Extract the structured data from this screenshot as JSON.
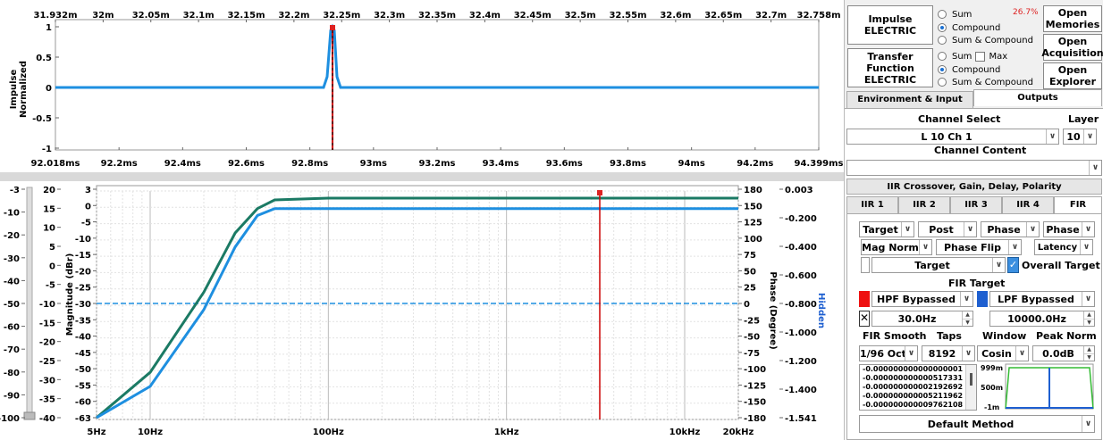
{
  "top_plot": {
    "ylabel": "Impulse\nNormalized",
    "time_ticks": [
      "31.932m",
      "32m",
      "32.05m",
      "32.1m",
      "32.15m",
      "32.2m",
      "32.25m",
      "32.3m",
      "32.35m",
      "32.4m",
      "32.45m",
      "32.5m",
      "32.55m",
      "32.6m",
      "32.65m",
      "32.7m",
      "32.758m"
    ],
    "ms_ticks": [
      "92.018ms",
      "92.2ms",
      "92.4ms",
      "92.6ms",
      "92.8ms",
      "93ms",
      "93.2ms",
      "93.4ms",
      "93.6ms",
      "93.8ms",
      "94ms",
      "94.2ms",
      "94.399ms"
    ],
    "y_ticks": [
      "1",
      "0.5",
      "0",
      "-0.5",
      "-1"
    ]
  },
  "bottom_plot": {
    "ylabel_mag": "Magnitude (dBr)",
    "ylabel_phase": "Phase (Degree)",
    "side_label": "Hidden",
    "scale1": [
      "-3",
      "-10",
      "-20",
      "-30",
      "-40",
      "-50",
      "-60",
      "-70",
      "-80",
      "-90",
      "-100"
    ],
    "scale2": [
      "20",
      "15",
      "10",
      "5",
      "0",
      "-5",
      "-10",
      "-15",
      "-20",
      "-25",
      "-30",
      "-35",
      "-40"
    ],
    "scale3": [
      "3",
      "0",
      "-5",
      "-10",
      "-15",
      "-20",
      "-25",
      "-30",
      "-35",
      "-40",
      "-45",
      "-50",
      "-55",
      "-60",
      "-63"
    ],
    "phase_ticks": [
      "180",
      "150",
      "125",
      "100",
      "75",
      "50",
      "25",
      "0",
      "-25",
      "-50",
      "-75",
      "-100",
      "-125",
      "-150",
      "-180"
    ],
    "group_ticks": [
      "0.003",
      "-0.200",
      "-0.400",
      "-0.600",
      "-0.800",
      "-1.000",
      "-1.200",
      "-1.400",
      "-1.541"
    ],
    "freq_ticks": [
      "5Hz",
      "10Hz",
      "100Hz",
      "1kHz",
      "10kHz",
      "20kHz"
    ]
  },
  "chart_data": {
    "type": "line",
    "x": [
      5,
      10,
      20,
      30,
      40,
      50,
      100,
      1000,
      10000,
      20000
    ],
    "series": [
      {
        "values": [
          -63,
          -50,
          -27,
          -10,
          -3,
          -0.5,
          0,
          0,
          0,
          0
        ],
        "color": "#1b7a64"
      },
      {
        "values": [
          -63,
          -54,
          -32,
          -14,
          -5,
          -3,
          -3,
          -3,
          -3,
          -3
        ],
        "color": "#1e8fe0"
      }
    ],
    "xlim": [
      5,
      20000
    ],
    "ylim": [
      -63,
      3
    ],
    "xscale": "log",
    "grid": true
  },
  "panel": {
    "impulse_btn": "Impulse\nELECTRIC",
    "percent": "26.7%",
    "open_memories": "Open\nMemories",
    "open_acquisition": "Open\nAcquisition",
    "open_explorer": "Open\nExplorer",
    "transfer_btn": "Transfer\nFunction\nELECTRIC",
    "radio_sum": "Sum",
    "radio_compound": "Compound",
    "radio_sum_compound": "Sum & Compound",
    "check_max": "Max",
    "tab_env": "Environment & Input",
    "tab_outputs": "Outputs",
    "channel_select_label": "Channel Select",
    "layer_label": "Layer",
    "channel_value": "L 10 Ch 1",
    "layer_value": "10",
    "channel_content_label": "Channel Content",
    "iir_header": "IIR Crossover, Gain, Delay, Polarity",
    "tabs2": [
      "IIR 1",
      "IIR 2",
      "IIR 3",
      "IIR 4",
      "FIR"
    ],
    "row1": [
      "Target",
      "Post",
      "Phase",
      "Phase"
    ],
    "mag_norm": "Mag Norm",
    "phase_flip": "Phase Flip",
    "latency": "Latency",
    "target": "Target",
    "overall_target": "Overall Target",
    "fir_target": "FIR Target",
    "hpf": "HPF Bypassed",
    "lpf": "LPF Bypassed",
    "hpf_freq": "30.0Hz",
    "lpf_freq": "10000.0Hz",
    "fir_smooth_label": "FIR Smooth",
    "taps_label": "Taps",
    "window_label": "Window",
    "peak_norm_label": "Peak Norm",
    "smooth_value": "1/96 Oct",
    "taps_value": "8192",
    "window_value": "Cosin",
    "peak_value": "0.0dB",
    "coeffs": [
      "-0.000000000000000001",
      "-0.000000000000517331",
      "-0.000000000002192692",
      "-0.000000000005211962",
      "-0.000000000009762108"
    ],
    "mini_ticks": [
      "999m",
      "500m",
      "-1m"
    ],
    "default_method": "Default Method"
  }
}
